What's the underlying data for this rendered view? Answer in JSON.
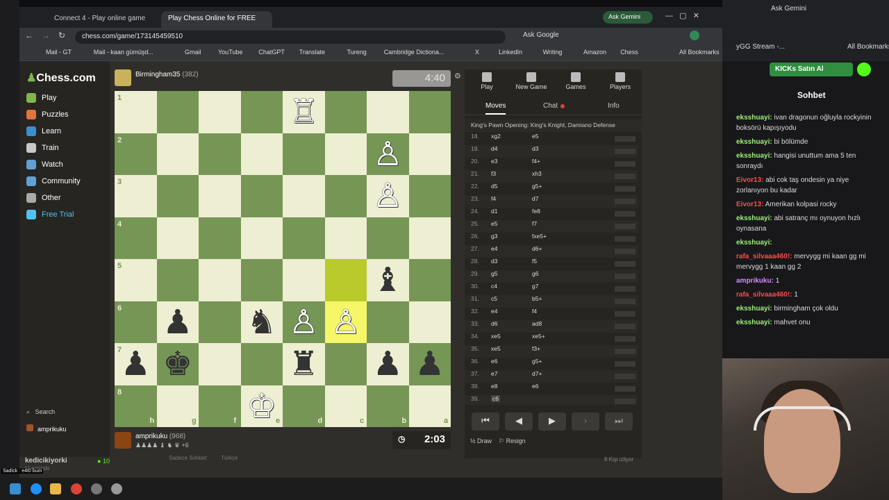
{
  "browser": {
    "tabs": [
      {
        "label": "Connect 4 - Play online game"
      },
      {
        "label": "Play Chess Online for FREE"
      }
    ],
    "url": "chess.com/game/173145459510",
    "ask_google": "Ask Google",
    "ask_gemini": "Ask Gemini",
    "bookmarks": [
      "Mail - GT",
      "Mail - kaan gümüşd...",
      "Gmail",
      "YouTube",
      "ChatGPT",
      "Translate",
      "Tureng",
      "Cambridge Dictiona...",
      "X",
      "LinkedIn",
      "Writing",
      "Amazon",
      "Chess"
    ],
    "all_bookmarks": "All Bookmarks"
  },
  "background_window": {
    "ask_gemini": "Ask Gemini",
    "bookmark_text": "yGG Stream -...",
    "all_bookmarks": "All Bookmarks",
    "kick_button": "KICKs Satın Al",
    "chat_title": "Sohbet",
    "chat": [
      {
        "user": "eksshuayi:",
        "text": "ivan dragonun oğluyla rockyinin boksörü kapışıyodu",
        "color": "green"
      },
      {
        "user": "eksshuayi:",
        "text": "bi bölümde",
        "color": "green"
      },
      {
        "user": "eksshuayi:",
        "text": "hangisi unuttum ama 5 ten sonraydı",
        "color": "green"
      },
      {
        "user": "Eivor13:",
        "text": "abi cok taş ondesin ya niye zorlanıyon bu kadar",
        "color": "red"
      },
      {
        "user": "Eivor13:",
        "text": "Amerikan kolpasi rocky",
        "color": "red"
      },
      {
        "user": "eksshuayi:",
        "text": "abi satranç mı oynuyon hızlı oynasana",
        "color": "green"
      },
      {
        "user": "eksshuayi:",
        "text": "",
        "color": "green"
      },
      {
        "user": "rafa_silvaaa460!:",
        "text": "mervygg mi kaan gg mi mervygg 1 kaan gg 2",
        "color": "red"
      },
      {
        "user": "amprikuku:",
        "text": "1",
        "color": "violet"
      },
      {
        "user": "rafa_silvaaa460!:",
        "text": "1",
        "color": "red"
      },
      {
        "user": "eksshuayi:",
        "text": "birmingham çok oldu",
        "color": "green"
      },
      {
        "user": "eksshuayi:",
        "text": "mahvet onu",
        "color": "green"
      }
    ],
    "viewers": "8 Kişi izliyor"
  },
  "sidebar": {
    "logo": "Chess.com",
    "items": [
      {
        "label": "Play",
        "color": "#81b64c"
      },
      {
        "label": "Puzzles",
        "color": "#e2743a"
      },
      {
        "label": "Learn",
        "color": "#3a8fd1"
      },
      {
        "label": "Train",
        "color": "#c8c8c8"
      },
      {
        "label": "Watch",
        "color": "#5fa0d6"
      },
      {
        "label": "Community",
        "color": "#5fa0d6"
      },
      {
        "label": "Other",
        "color": "#aaaaaa"
      },
      {
        "label": "Free Trial",
        "color": "#4fc3f7"
      }
    ],
    "search": "Search",
    "username": "amprikuku"
  },
  "game": {
    "opponent": {
      "name": "Birmingham35",
      "rating": "(382)",
      "clock": "4:40"
    },
    "player": {
      "name": "amprikuku",
      "rating": "(968)",
      "clock": "2:03",
      "captured_extra": "+6"
    },
    "board": {
      "rank_labels": [
        "1",
        "2",
        "3",
        "4",
        "5",
        "6",
        "7",
        "8"
      ],
      "file_labels": [
        "h",
        "g",
        "f",
        "e",
        "d",
        "c",
        "b",
        "a"
      ],
      "pieces": [
        {
          "row": 0,
          "col": 4,
          "glyph": "♖",
          "color": "w"
        },
        {
          "row": 1,
          "col": 6,
          "glyph": "♙",
          "color": "w"
        },
        {
          "row": 2,
          "col": 6,
          "glyph": "♙",
          "color": "w"
        },
        {
          "row": 4,
          "col": 6,
          "glyph": "♝",
          "color": "b"
        },
        {
          "row": 5,
          "col": 1,
          "glyph": "♟",
          "color": "b"
        },
        {
          "row": 5,
          "col": 3,
          "glyph": "♞",
          "color": "b"
        },
        {
          "row": 5,
          "col": 4,
          "glyph": "♙",
          "color": "w"
        },
        {
          "row": 5,
          "col": 5,
          "glyph": "♙",
          "color": "w"
        },
        {
          "row": 6,
          "col": 0,
          "glyph": "♟",
          "color": "b"
        },
        {
          "row": 6,
          "col": 1,
          "glyph": "♚",
          "color": "b"
        },
        {
          "row": 6,
          "col": 4,
          "glyph": "♜",
          "color": "b"
        },
        {
          "row": 6,
          "col": 6,
          "glyph": "♟",
          "color": "b"
        },
        {
          "row": 6,
          "col": 7,
          "glyph": "♟",
          "color": "b"
        },
        {
          "row": 7,
          "col": 3,
          "glyph": "♔",
          "color": "w"
        }
      ],
      "highlight_from": {
        "row": 4,
        "col": 5
      },
      "highlight_to": {
        "row": 5,
        "col": 5
      }
    }
  },
  "panel": {
    "tabs": [
      "Play",
      "New Game",
      "Games",
      "Players"
    ],
    "subtabs": [
      "Moves",
      "Chat",
      "Info"
    ],
    "opening": "King's Pawn Opening: King's Knight, Damiano Defense",
    "moves": [
      {
        "n": "18.",
        "w": "xg2",
        "b": "e5"
      },
      {
        "n": "19.",
        "w": "d4",
        "b": "d3"
      },
      {
        "n": "20.",
        "w": "e3",
        "b": "f4+"
      },
      {
        "n": "21.",
        "w": "f3",
        "b": "xh3"
      },
      {
        "n": "22.",
        "w": "d5",
        "b": "g5+"
      },
      {
        "n": "23.",
        "w": "f4",
        "b": "d7"
      },
      {
        "n": "24.",
        "w": "d1",
        "b": "fe8"
      },
      {
        "n": "25.",
        "w": "e5",
        "b": "f7"
      },
      {
        "n": "26.",
        "w": "g3",
        "b": "fxe5+"
      },
      {
        "n": "27.",
        "w": "e4",
        "b": "d6+"
      },
      {
        "n": "28.",
        "w": "d3",
        "b": "f5"
      },
      {
        "n": "29.",
        "w": "g5",
        "b": "g6"
      },
      {
        "n": "30.",
        "w": "c4",
        "b": "g7"
      },
      {
        "n": "31.",
        "w": "c5",
        "b": "b5+"
      },
      {
        "n": "32.",
        "w": "e4",
        "b": "f4"
      },
      {
        "n": "33.",
        "w": "d6",
        "b": "ad8"
      },
      {
        "n": "34.",
        "w": "xe5",
        "b": "xe5+"
      },
      {
        "n": "35.",
        "w": "xe5",
        "b": "f3+"
      },
      {
        "n": "36.",
        "w": "e6",
        "b": "g5+"
      },
      {
        "n": "37.",
        "w": "e7",
        "b": "d7+"
      },
      {
        "n": "38.",
        "w": "e8",
        "b": "e6"
      },
      {
        "n": "39.",
        "w": "c6",
        "b": ""
      }
    ],
    "draw": "Draw",
    "resign": "Resign"
  },
  "bottom": {
    "stream_user": "kedicikiyorki",
    "stream_sub": "f Legends",
    "viewers": "10",
    "chat_hint": "Sadece Sohbet",
    "lang": "Türkçe",
    "caption": "SadIck : e4t0 bum"
  }
}
